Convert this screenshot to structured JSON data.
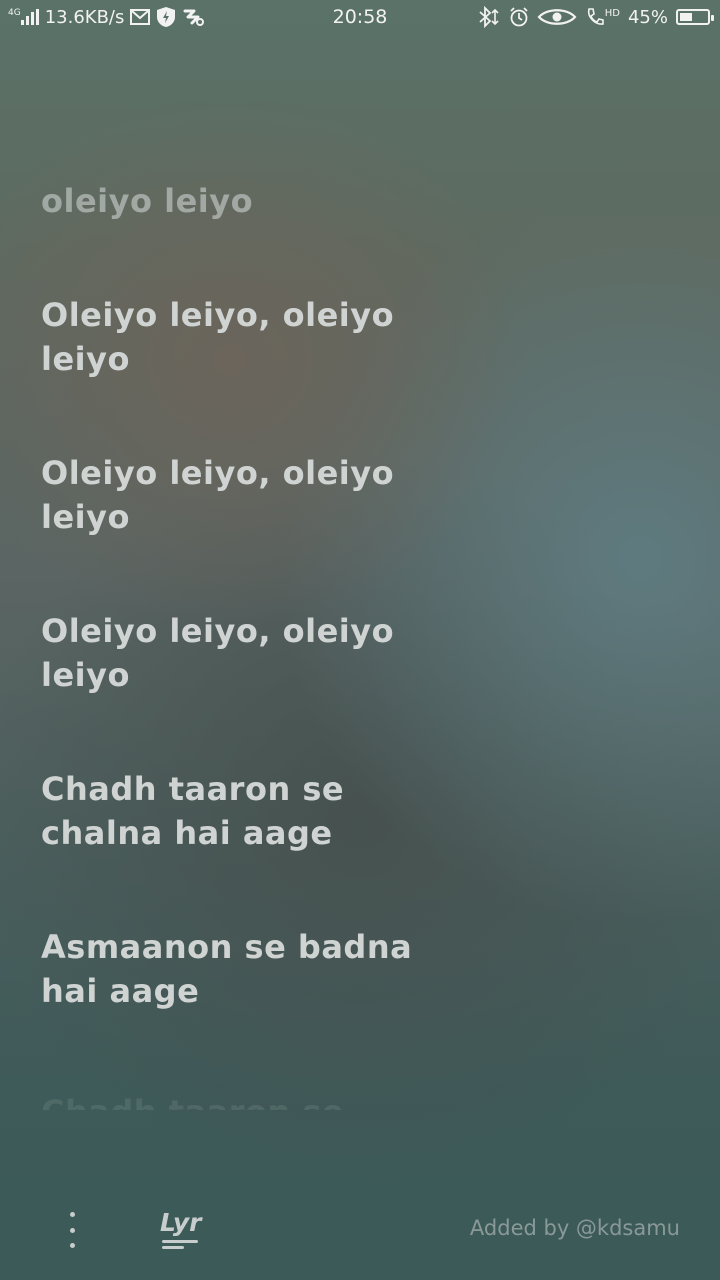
{
  "status_bar": {
    "network_type": "4G",
    "speed": "13.6KB/s",
    "time": "20:58",
    "call_badge": "HD",
    "battery_percent": "45%",
    "battery_level": 0.45,
    "icons": [
      "signal-icon",
      "mail-icon",
      "shield-icon",
      "app-icon",
      "bluetooth-icon",
      "alarm-icon",
      "eye-icon",
      "call-hd-icon",
      "battery-icon"
    ]
  },
  "lyrics": {
    "lines": [
      "oleiyo leiyo",
      "Oleiyo leiyo, oleiyo leiyo",
      "Oleiyo leiyo, oleiyo leiyo",
      "Oleiyo leiyo, oleiyo leiyo",
      "Chadh taaron se chalna hai aage",
      "Asmaanon se badna hai aage",
      "Chadh taaron se"
    ]
  },
  "bottom_bar": {
    "lyr_label": "Lyr",
    "credit": "Added by @kdsamu"
  }
}
